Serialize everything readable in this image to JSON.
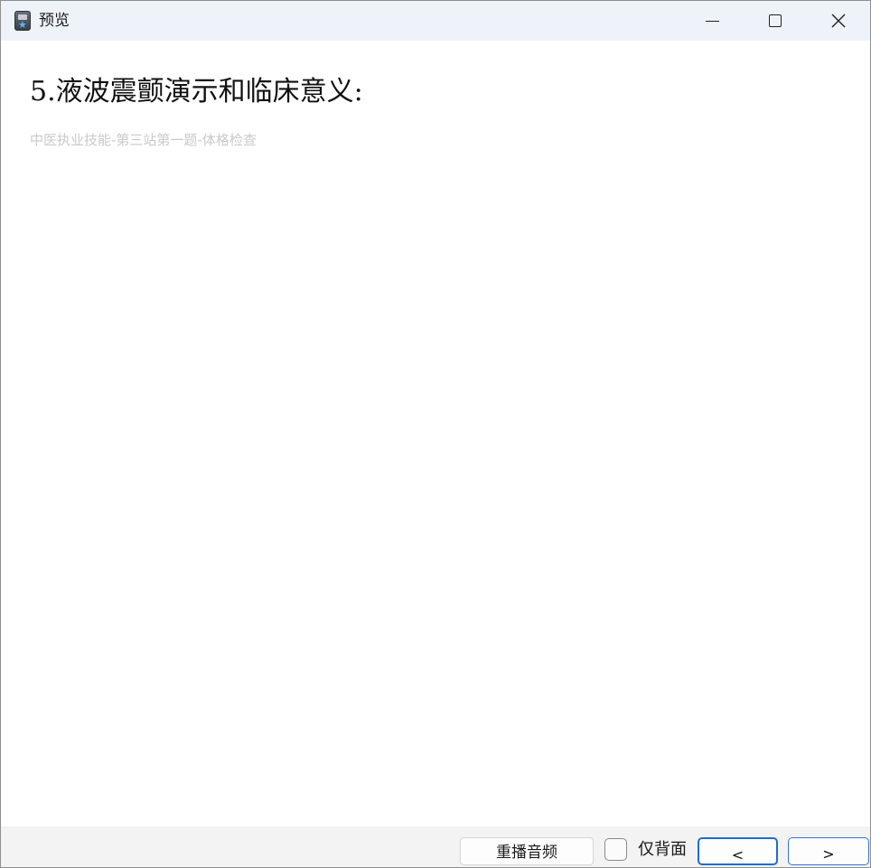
{
  "window": {
    "title": "预览",
    "icon": "app-icon"
  },
  "controls": {
    "minimize_icon": "minimize-icon",
    "maximize_icon": "maximize-icon",
    "close_icon": "close-icon"
  },
  "content": {
    "heading": "5.液波震颤演示和临床意义:",
    "subtitle": "中医执业技能-第三站第一题-体格检查"
  },
  "footer": {
    "replay_label": "重播音频",
    "back_only_label": "仅背面",
    "back_only_checked": false,
    "prev_label": "<",
    "next_label": ">"
  },
  "colors": {
    "titlebar_bg": "#eef3fa",
    "accent": "#1f6ccf",
    "subtitle_text": "#c9c9c9",
    "footer_bg": "#f3f3f3"
  }
}
